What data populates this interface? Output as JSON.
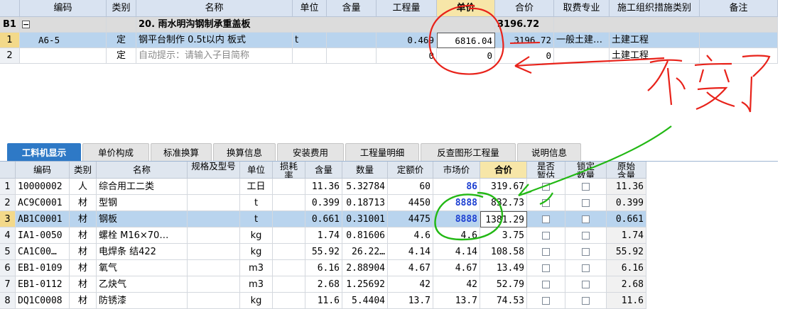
{
  "top_headers": [
    "编码",
    "类别",
    "名称",
    "单位",
    "含量",
    "工程量",
    "单价",
    "合价",
    "取费专业",
    "施工组织措施类别",
    "备注"
  ],
  "group_row": {
    "code": "B1",
    "expand": "−",
    "name": "20. 雨水明沟钢制承重盖板",
    "total": "3196.72"
  },
  "rows": [
    {
      "num": "1",
      "code": "A6-5",
      "type": "定",
      "name": "钢平台制作 0.5t以内 板式",
      "unit": "t",
      "qty": "0.469",
      "price": "6816.04",
      "total": "3196.72",
      "specialty": "一般土建…",
      "measure": "土建工程"
    },
    {
      "num": "2",
      "code": "",
      "type": "定",
      "name": "自动提示：请输入子目简称",
      "unit": "",
      "qty": "0",
      "price": "0",
      "total": "0",
      "specialty": "",
      "measure": "土建工程"
    }
  ],
  "tabs": [
    "工料机显示",
    "单价构成",
    "标准换算",
    "换算信息",
    "安装费用",
    "工程量明细",
    "反查图形工程量",
    "说明信息"
  ],
  "bottom_headers": [
    "编码",
    "类别",
    "名称",
    "规格及型号",
    "单位",
    "损耗率",
    "含量",
    "数量",
    "定额价",
    "市场价",
    "合价",
    "是否暂估",
    "锁定数量",
    "原始含量"
  ],
  "bottom_rows": [
    {
      "num": "1",
      "code": "10000002",
      "type": "人",
      "name": "综合用工二类",
      "unit": "工日",
      "content": "11.36",
      "qty": "5.32784",
      "quota": "60",
      "market": "86",
      "total": "319.67",
      "orig": "11.36"
    },
    {
      "num": "2",
      "code": "AC9C0001",
      "type": "材",
      "name": "型钢",
      "unit": "t",
      "content": "0.399",
      "qty": "0.18713",
      "quota": "4450",
      "market": "8888",
      "total": "832.73",
      "orig": "0.399"
    },
    {
      "num": "3",
      "code": "AB1C0001",
      "type": "材",
      "name": "钢板",
      "unit": "t",
      "content": "0.661",
      "qty": "0.31001",
      "quota": "4475",
      "market": "8888",
      "total": "1381.29",
      "orig": "0.661"
    },
    {
      "num": "4",
      "code": "IA1-0050",
      "type": "材",
      "name": "螺栓 M16×70…",
      "unit": "kg",
      "content": "1.74",
      "qty": "0.81606",
      "quota": "4.6",
      "market": "4.6",
      "total": "3.75",
      "orig": "1.74"
    },
    {
      "num": "5",
      "code": "CA1C00…",
      "type": "材",
      "name": "电焊条 结422",
      "unit": "kg",
      "content": "55.92",
      "qty": "26.22…",
      "quota": "4.14",
      "market": "4.14",
      "total": "108.58",
      "orig": "55.92"
    },
    {
      "num": "6",
      "code": "EB1-0109",
      "type": "材",
      "name": "氧气",
      "unit": "m3",
      "content": "6.16",
      "qty": "2.88904",
      "quota": "4.67",
      "market": "4.67",
      "total": "13.49",
      "orig": "6.16"
    },
    {
      "num": "7",
      "code": "EB1-0112",
      "type": "材",
      "name": "乙炔气",
      "unit": "m3",
      "content": "2.68",
      "qty": "1.25692",
      "quota": "42",
      "market": "42",
      "total": "52.79",
      "orig": "2.68"
    },
    {
      "num": "8",
      "code": "DQ1C0008",
      "type": "材",
      "name": "防锈漆",
      "unit": "kg",
      "content": "11.6",
      "qty": "5.4404",
      "quota": "13.7",
      "market": "13.7",
      "total": "74.53",
      "orig": "11.6"
    }
  ],
  "annotation_text": "不变了",
  "colors": {
    "header_bg": "#d9e3f1",
    "selected_row": "#b9d4ee",
    "tab_active": "#2e79c6",
    "red_ink": "#e8221a",
    "green_ink": "#22b814",
    "market_blue": "#1c3fd1"
  }
}
